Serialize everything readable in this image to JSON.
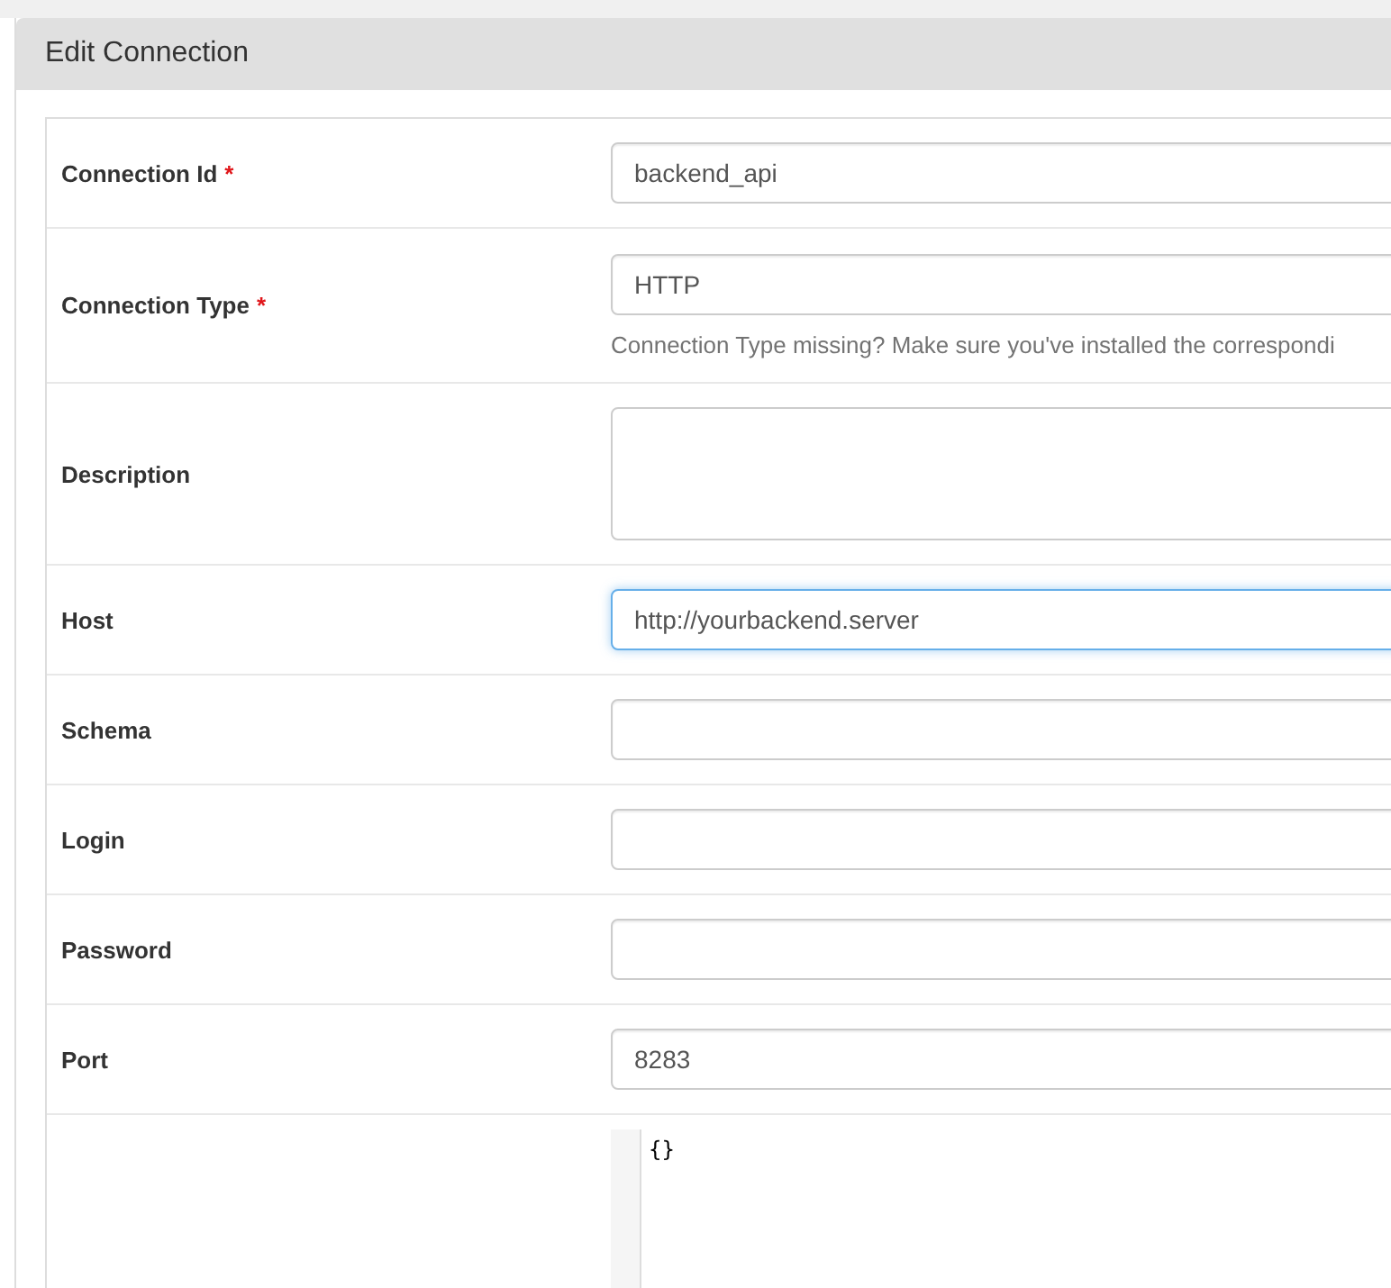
{
  "panel": {
    "title": "Edit Connection"
  },
  "fields": [
    {
      "label": "Connection Id",
      "required_mark": "*",
      "kind": "text",
      "value": "backend_api"
    },
    {
      "label": "Connection Type",
      "required_mark": "*",
      "kind": "text",
      "value": "HTTP",
      "help": "Connection Type missing? Make sure you've installed the correspondi"
    },
    {
      "label": "Description",
      "kind": "textarea"
    },
    {
      "label": "Host",
      "kind": "text",
      "value": "http://yourbackend.server",
      "focused": true
    },
    {
      "label": "Schema",
      "kind": "text"
    },
    {
      "label": "Login",
      "kind": "text"
    },
    {
      "label": "Password",
      "kind": "text"
    },
    {
      "label": "Port",
      "kind": "text",
      "value": "8283"
    },
    {
      "kind": "code",
      "value": "{}"
    }
  ]
}
